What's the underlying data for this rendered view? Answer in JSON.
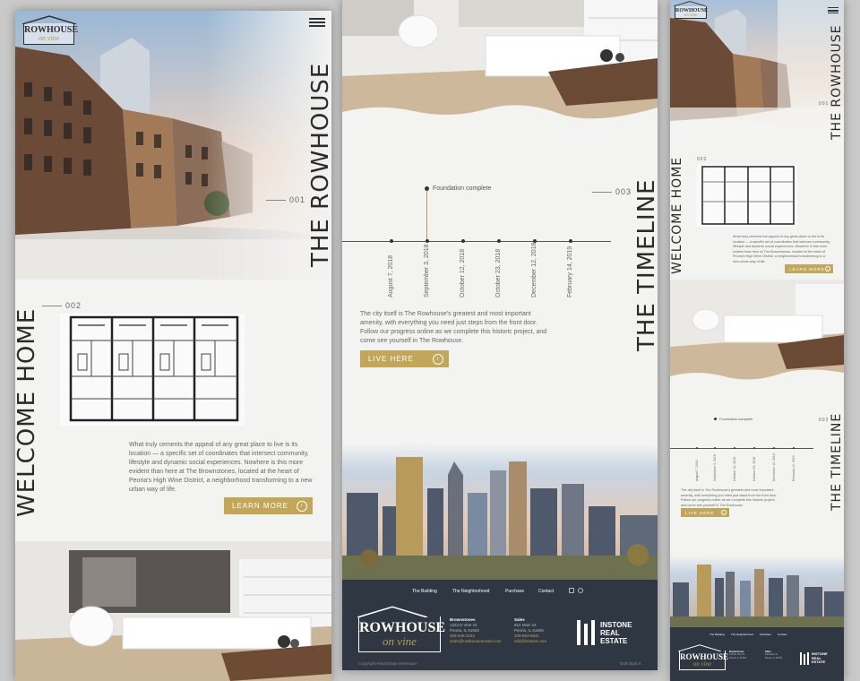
{
  "brand": {
    "name": "ROWHOUSE",
    "sub": "on vine"
  },
  "home": {
    "title": "THE ROWHOUSE",
    "section_num": "001",
    "welcome": "WELCOME HOME",
    "section2_num": "002",
    "body": "What truly cements the appeal of any great place to live is its location — a specific set of coordinates that intersect community, lifestyle and dynamic social experiences. Nowhere is this more evident than here at The Brownstones, located at the heart of Peoria's High Wine District, a neighborhood transforming to a new urban way of life.",
    "cta": "LEARN MORE"
  },
  "timeline": {
    "title": "THE TIMELINE",
    "section_num": "003",
    "milestone": "Foundation complete",
    "dates": [
      "August 7, 2018",
      "September 3, 2018",
      "October 12, 2018",
      "October 23, 2018",
      "December 12, 2018",
      "February 14, 2019"
    ],
    "body": "The city itself is The Rowhouse's greatest and most important amenity, with everything you need just steps from the front door. Follow our progress online as we complete this historic project, and come see yourself in The Rowhouse.",
    "cta": "LIVE HERE"
  },
  "footer": {
    "nav": [
      "The Building",
      "The Neighborhood",
      "Purchase",
      "Contact"
    ],
    "col1": {
      "title": "Brownstones",
      "lines": [
        "1323 E Vine St.",
        "Peoria, IL 61602",
        "309-648-1234",
        "sales@rowhouseonvine.com"
      ]
    },
    "col2": {
      "title": "Sales",
      "lines": [
        "812 Main St.",
        "Peoria, IL 61606",
        "309-553-5641",
        "info@instone.com"
      ]
    },
    "partner": [
      "INSTONE",
      "REAL",
      "ESTATE"
    ],
    "copyright": "Copyright Real Estate Developer",
    "credit": "Dark Built It"
  },
  "colors": {
    "accent": "#c2a65a",
    "footer": "#2f3742",
    "page": "#f3f3f1"
  }
}
